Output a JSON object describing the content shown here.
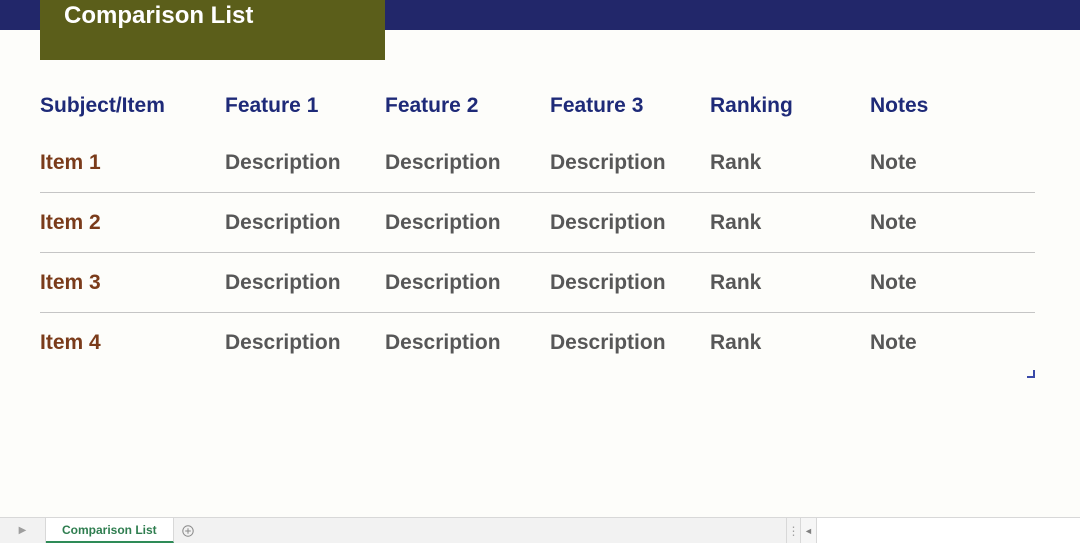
{
  "title": "Comparison List",
  "headers": [
    "Subject/Item",
    "Feature 1",
    "Feature 2",
    "Feature 3",
    "Ranking",
    "Notes"
  ],
  "rows": [
    {
      "name": "Item 1",
      "f1": "Description",
      "f2": "Description",
      "f3": "Description",
      "rank": "Rank",
      "note": "Note"
    },
    {
      "name": "Item 2",
      "f1": "Description",
      "f2": "Description",
      "f3": "Description",
      "rank": "Rank",
      "note": "Note"
    },
    {
      "name": "Item 3",
      "f1": "Description",
      "f2": "Description",
      "f3": "Description",
      "rank": "Rank",
      "note": "Note"
    },
    {
      "name": "Item 4",
      "f1": "Description",
      "f2": "Description",
      "f3": "Description",
      "rank": "Rank",
      "note": "Note"
    }
  ],
  "sheet_tab": "Comparison List"
}
